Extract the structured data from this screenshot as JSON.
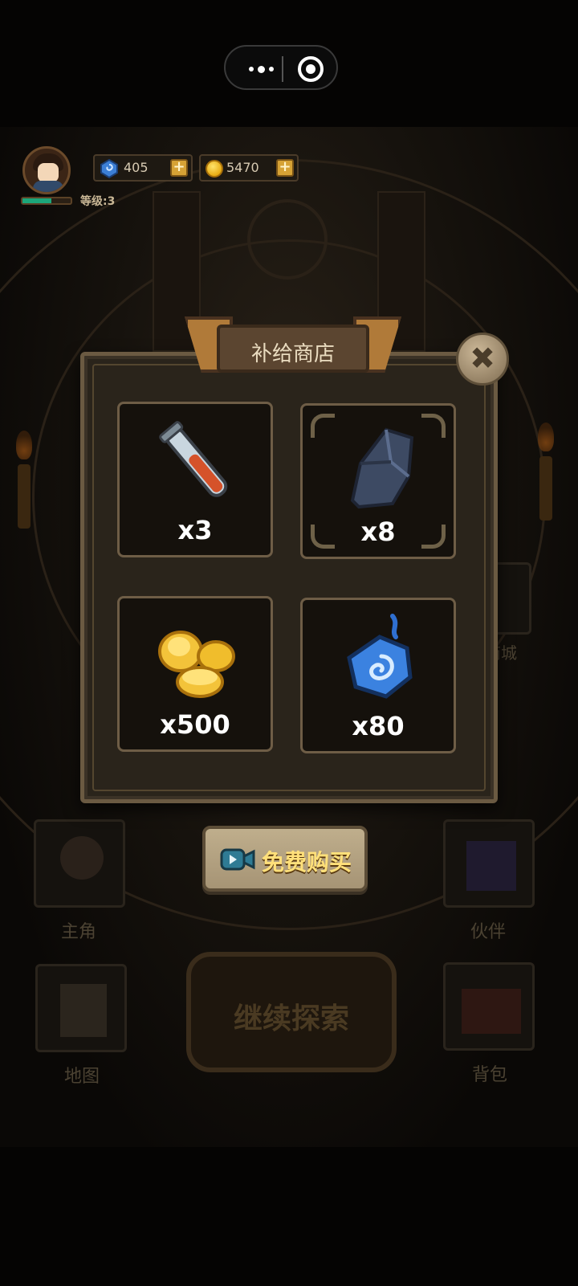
{
  "hud": {
    "gems": "405",
    "gold": "5470",
    "level_label": "等级:3",
    "xp_fill": 0.6
  },
  "shop": {
    "title": "补给商店",
    "items": [
      {
        "name": "potion",
        "qty": "x3"
      },
      {
        "name": "ore",
        "qty": "x8"
      },
      {
        "name": "gold-coins",
        "qty": "x500"
      },
      {
        "name": "gem",
        "qty": "x80"
      }
    ],
    "buy_label": "免费购买"
  },
  "background_menu": {
    "hero": "主角",
    "partner": "伙伴",
    "map": "地图",
    "bag": "背包",
    "mall": "商城",
    "explore": "继续探索"
  },
  "colors": {
    "accent_gold": "#ffe07a",
    "xp_green": "#1ca67a",
    "panel_border": "#6e5d46"
  }
}
